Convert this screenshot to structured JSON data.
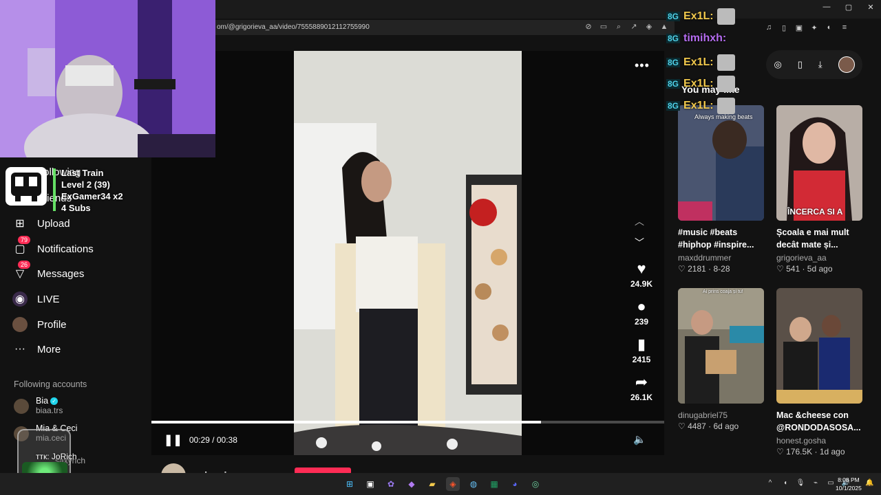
{
  "browser": {
    "url": "om/@grigorieva_aa/video/7555889012112755990",
    "addr_icons": [
      "⊘",
      "▭",
      "⌕",
      "↗",
      "◈",
      "▲"
    ],
    "toolbar_icons": [
      "♫",
      "▯",
      "▣",
      "✦",
      "◐",
      "≡"
    ],
    "win_controls": [
      "—",
      "▢",
      "✕"
    ]
  },
  "overlay": {
    "alert": {
      "line1": "Last Train",
      "line2": "Level 2  (39)",
      "line3": "ExGamer34 x2",
      "line4": "4 Subs"
    },
    "jar_label": "ттк: JoRich",
    "chat": [
      {
        "badge": "8G",
        "name": "Ex1L:",
        "color": "#f2c94c"
      },
      {
        "badge": "8G",
        "name": "timihxh:",
        "color": "#b56cf0"
      },
      {
        "badge": "8G",
        "name": "Ex1L:",
        "color": "#f2c94c"
      },
      {
        "badge": "8G",
        "name": "Ex1L:",
        "color": "#f2c94c"
      },
      {
        "badge": "8G",
        "name": "Ex1L:",
        "color": "#f2c94c"
      }
    ]
  },
  "sidebar": {
    "items": [
      {
        "label": "Following",
        "icon": "following-icon"
      },
      {
        "label": "Friends",
        "icon": "friends-icon"
      },
      {
        "label": "Upload",
        "icon": "upload-icon"
      },
      {
        "label": "Notifications",
        "icon": "notifications-icon",
        "badge": "79"
      },
      {
        "label": "Messages",
        "icon": "messages-icon",
        "badge": "26"
      },
      {
        "label": "LIVE",
        "icon": "live-icon"
      },
      {
        "label": "Profile",
        "icon": "profile-icon"
      },
      {
        "label": "More",
        "icon": "more-icon"
      }
    ],
    "following_heading": "Following accounts",
    "accounts": [
      {
        "name": "Bia",
        "user": "biaa.trs",
        "verified": true
      },
      {
        "name": "Mia & Ceci",
        "user": "mia.ceci"
      },
      {
        "name": "",
        "user": "...saxyrich"
      }
    ]
  },
  "video": {
    "more_label": "•••",
    "time_current": "00:29",
    "time_total": "00:38",
    "progress_fraction": 0.76,
    "likes": "24.9K",
    "comments": "239",
    "saves": "2415",
    "shares": "26.1K",
    "author": "grigorieva_aa"
  },
  "suggestions": {
    "heading": "You may like",
    "cards": [
      {
        "desc": "#music #beats #hiphop #inspire...",
        "author": "maxddrummer",
        "likes": "2181",
        "date": "8-28",
        "overlay": "Always making beats",
        "thumb": "#3a4560"
      },
      {
        "desc": "Școala e mai mult decât mate și...",
        "author": "grigorieva_aa",
        "likes": "541",
        "date": "5d ago",
        "overlay": "ÎNCERCA SI A",
        "thumb": "#8a6c6a"
      },
      {
        "desc": "",
        "author": "dinugabriel75",
        "likes": "4487",
        "date": "6d ago",
        "overlay": "Ai prins coaja și tu!",
        "thumb": "#6a6355"
      },
      {
        "desc": "Mac &cheese con @RONDODASOSA...",
        "author": "honest.gosha",
        "likes": "176.5K",
        "date": "1d ago",
        "overlay": "",
        "thumb": "#4a4038"
      }
    ]
  },
  "taskbar": {
    "time": "8:08 PM",
    "date": "10/1/2025",
    "tray": [
      "^",
      "◖",
      "🎙",
      "⌁",
      "▭",
      "🔊"
    ]
  },
  "colors": {
    "accent": "#fe2c55",
    "background": "#121212",
    "verified": "#20d5ec"
  }
}
